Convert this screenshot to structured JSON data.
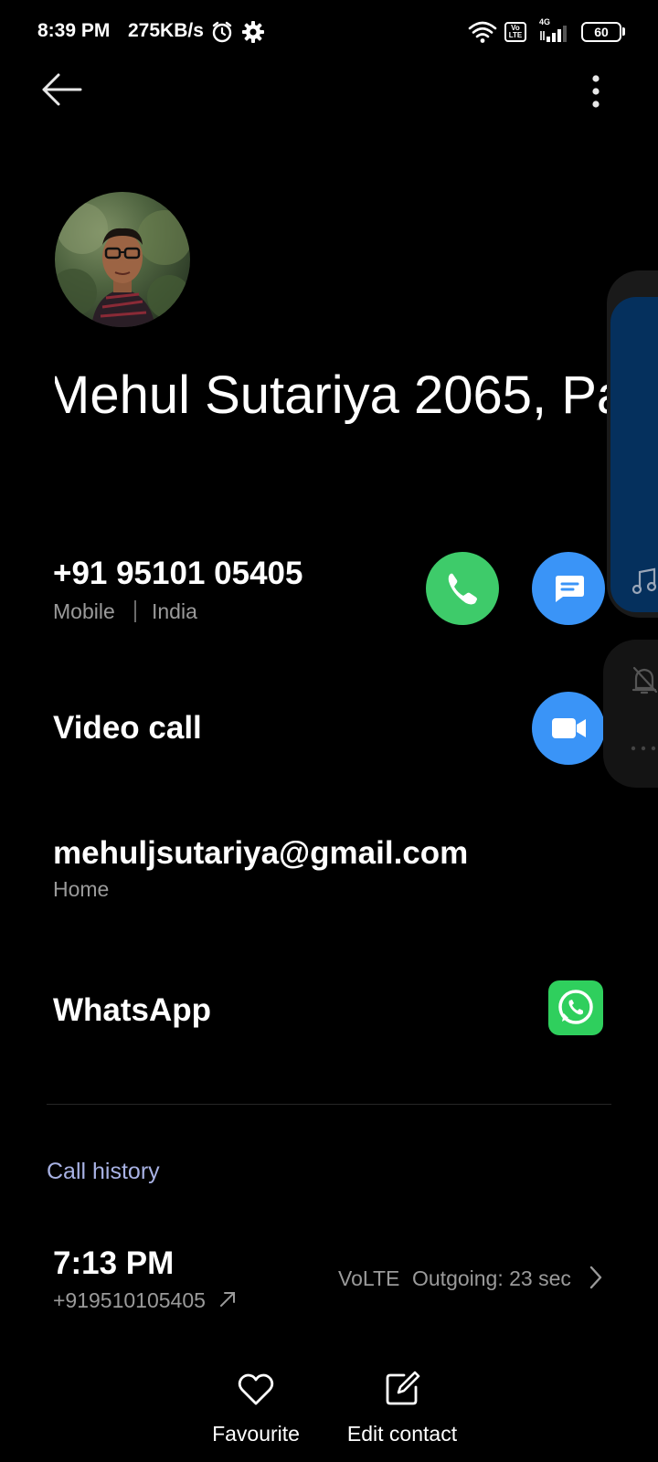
{
  "status_bar": {
    "time": "8:39 PM",
    "net_speed": "275KB/s",
    "volte_badge": "Vo LTE",
    "network_type": "4G",
    "battery": "60"
  },
  "contact": {
    "name": "Mehul Sutariya 2065, Pa"
  },
  "phone": {
    "number": "+91 95101 05405",
    "type": "Mobile",
    "country": "India"
  },
  "video_call": {
    "label": "Video call"
  },
  "email": {
    "address": "mehuljsutariya@gmail.com",
    "type": "Home"
  },
  "whatsapp": {
    "label": "WhatsApp"
  },
  "call_history": {
    "title": "Call history",
    "entries": [
      {
        "time": "7:13 PM",
        "number": "+919510105405",
        "network": "VoLTE",
        "detail": "Outgoing: 23 sec"
      }
    ]
  },
  "bottom_bar": {
    "favourite_label": "Favourite",
    "edit_label": "Edit contact"
  },
  "colors": {
    "call_green": "#3ecb6a",
    "action_blue": "#3a94f7",
    "whatsapp_green": "#2fcf5d",
    "section_title": "#a8b2e4",
    "secondary_text": "#9a9a9a"
  }
}
